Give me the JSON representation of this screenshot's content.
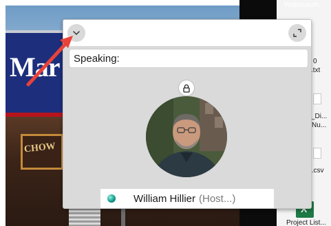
{
  "desktop": {
    "top_label": "Webexauth...",
    "items": [
      {
        "label": "0"
      },
      {
        "label": ".txt"
      },
      {
        "label": "_Di..."
      },
      {
        "label": "Nu..."
      },
      {
        "label": "t.csv"
      },
      {
        "label": "Project List..."
      }
    ]
  },
  "background": {
    "sign_text": "Mar",
    "awning_text": "CHOW"
  },
  "meeting_panel": {
    "speaking_label": "Speaking:",
    "participant": {
      "name": "William Hillier",
      "role": "(Host...)"
    }
  },
  "colors": {
    "annotation_arrow": "#e8433a",
    "panel_background": "#dadada",
    "status_indicator": "#1aa58f"
  },
  "icons": {
    "collapse": "chevron-down-icon",
    "expand": "expand-arrows-icon",
    "lock": "lock-icon",
    "status": "status-indicator-icon"
  }
}
